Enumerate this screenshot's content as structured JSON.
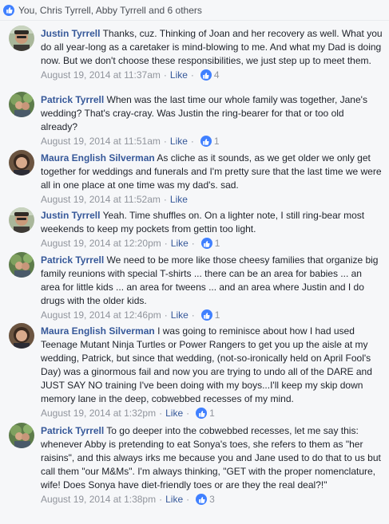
{
  "reactions": {
    "summary": "You, Chris Tyrrell, Abby Tyrrell and 6 others",
    "icon": "like-icon",
    "color": "#4080ff"
  },
  "colors": {
    "link": "#365899",
    "meta": "#90949c"
  },
  "comments": [
    {
      "author": "Justin Tyrrell",
      "text": "Thanks, cuz. Thinking of Joan and her recovery as well. What you do all year-long as a caretaker is mind-blowing to me. And what my Dad is doing now. But we don't choose these responsibilities, we just step up to meet them.",
      "timestamp": "August 19, 2014 at 11:37am",
      "like_label": "Like",
      "like_count": "4"
    },
    {
      "author": "Patrick Tyrrell",
      "text": "When was the last time our whole family was together, Jane's wedding? That's cray-cray. Was Justin the ring-bearer for that or too old already?",
      "timestamp": "August 19, 2014 at 11:51am",
      "like_label": "Like",
      "like_count": "1"
    },
    {
      "author": "Maura English Silverman",
      "text": "As cliche as it sounds, as we get older we only get together for weddings and funerals and I'm pretty sure that the last time we were all in one place at one time was my dad's. sad.",
      "timestamp": "August 19, 2014 at 11:52am",
      "like_label": "Like",
      "like_count": ""
    },
    {
      "author": "Justin Tyrrell",
      "text": "Yeah. Time shuffles on. On a lighter note, I still ring-bear most weekends to keep my pockets from gettin too light.",
      "timestamp": "August 19, 2014 at 12:20pm",
      "like_label": "Like",
      "like_count": "1"
    },
    {
      "author": "Patrick Tyrrell",
      "text": "We need to be more like those cheesy families that organize big family reunions with special T-shirts ... there can be an area for babies ... an area for little kids ... an area for tweens ... and an area where Justin and I do drugs with the older kids.",
      "timestamp": "August 19, 2014 at 12:46pm",
      "like_label": "Like",
      "like_count": "1"
    },
    {
      "author": "Maura English Silverman",
      "text": "I was going to reminisce about how I had used Teenage Mutant Ninja Turtles or Power Rangers to get you up the aisle at my wedding, Patrick, but since that wedding, (not-so-ironically held on April Fool's Day) was a ginormous fail and now you are trying to undo all of the DARE and JUST SAY NO training I've been doing with my boys...I'll keep my skip down memory lane in the deep, cobwebbed recesses of my mind.",
      "timestamp": "August 19, 2014 at 1:32pm",
      "like_label": "Like",
      "like_count": "1"
    },
    {
      "author": "Patrick Tyrrell",
      "text": "To go deeper into the cobwebbed recesses, let me say this: whenever Abby is pretending to eat Sonya's toes, she refers to them as \"her raisins\", and this always irks me because you and Jane used to do that to us but call them \"our M&Ms\". I'm always thinking, \"GET with the proper nomenclature, wife! Does Sonya have diet-friendly toes or are they the real deal?!\"",
      "timestamp": "August 19, 2014 at 1:38pm",
      "like_label": "Like",
      "like_count": "3"
    }
  ]
}
